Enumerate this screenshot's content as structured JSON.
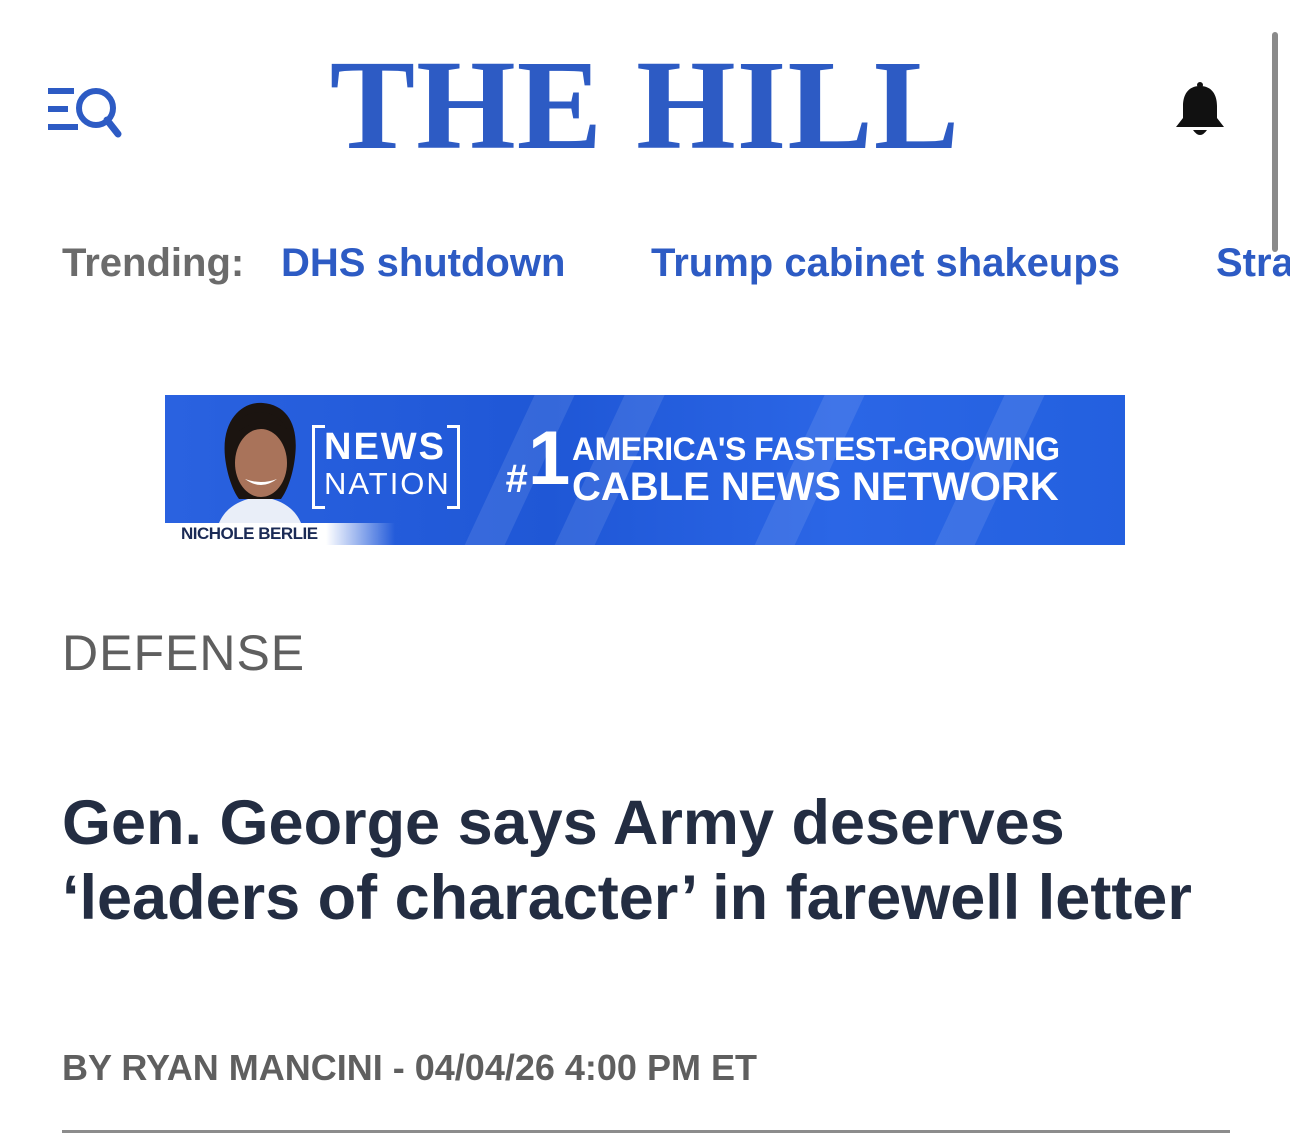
{
  "header": {
    "logo_text": "THE HILL",
    "menu_icon": "menu-search-icon",
    "bell_icon": "bell-icon",
    "brand_color": "#2d5bc4"
  },
  "trending": {
    "label": "Trending:",
    "items": [
      "DHS shutdown",
      "Trump cabinet shakeups",
      "Stra"
    ]
  },
  "ad": {
    "person_name": "NICHOLE BERLIE",
    "brand_line1": "NEWS",
    "brand_line2": "NATION",
    "rank_hash": "#",
    "rank_number": "1",
    "tagline_line1": "AMERICA'S FASTEST-GROWING",
    "tagline_line2": "CABLE NEWS NETWORK"
  },
  "article": {
    "section": "DEFENSE",
    "headline": "Gen. George says Army deserves ‘leaders of character’ in farewell letter",
    "byline_prefix": "BY",
    "author": "RYAN MANCINI",
    "separator": "-",
    "datetime": "04/04/26 4:00 PM ET"
  }
}
